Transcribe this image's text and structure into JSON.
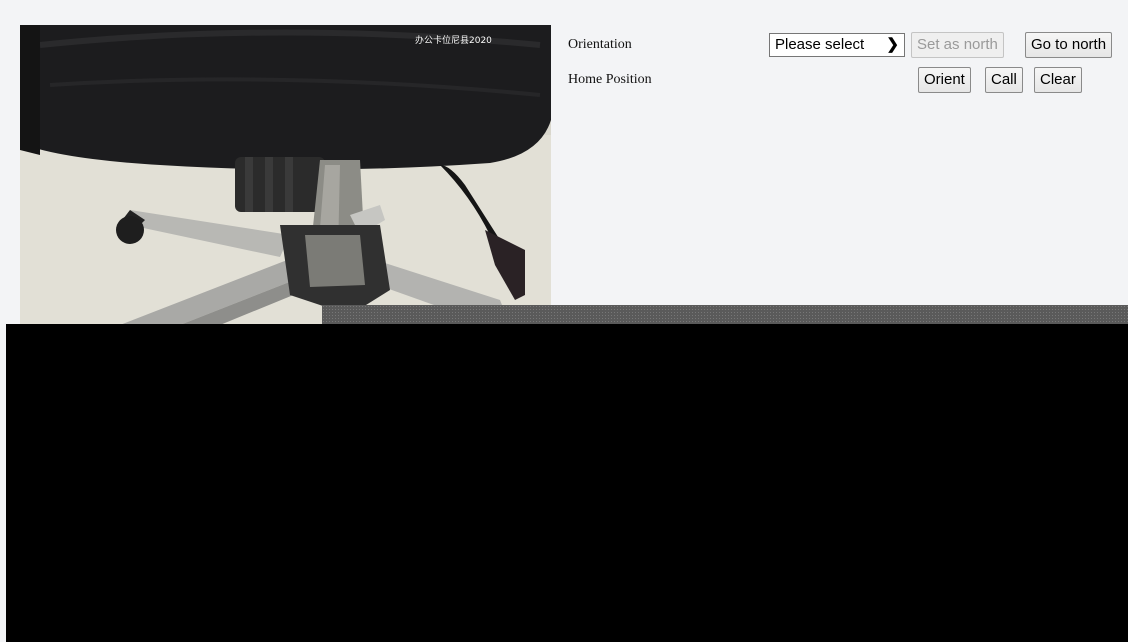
{
  "video": {
    "osd_text": "办公卡位尼县2020"
  },
  "orientation": {
    "label": "Orientation",
    "select_value": "Please select",
    "set_as_north_label": "Set as north",
    "go_to_north_label": "Go to north"
  },
  "home_position": {
    "label": "Home Position",
    "orient_label": "Orient",
    "call_label": "Call",
    "clear_label": "Clear"
  }
}
